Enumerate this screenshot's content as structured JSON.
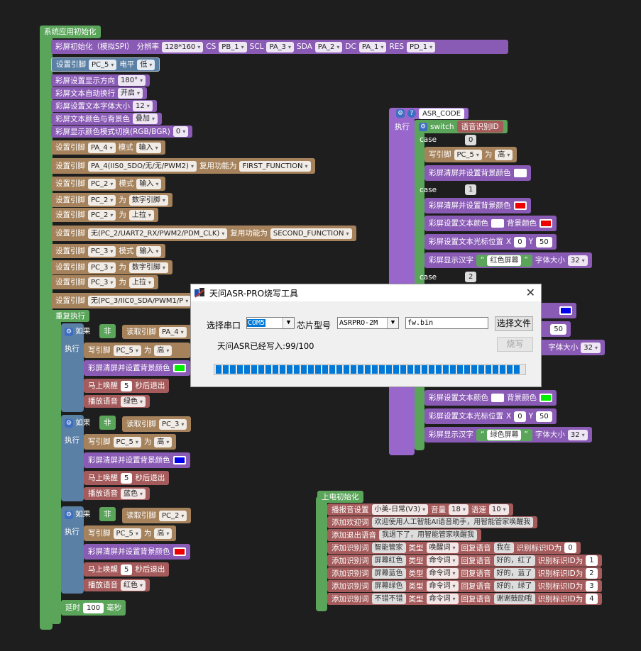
{
  "main": {
    "hat": "系统应用初始化",
    "spi": {
      "label": "彩屏初始化（模拟SPI）",
      "res_label": "分辨率",
      "res": "128*160",
      "cs_label": "CS",
      "cs": "PB_1",
      "scl_label": "SCL",
      "scl": "PA_3",
      "sda_label": "SDA",
      "sda": "PA_2",
      "dc_label": "DC",
      "dc": "PA_1",
      "rst_label": "RES",
      "rst": "PD_1"
    },
    "pin1": {
      "label": "设置引脚",
      "pin": "PC_5",
      "lvl_label": "电平",
      "lvl": "低"
    },
    "dir": {
      "label": "彩屏设置显示方向",
      "val": "180°"
    },
    "wrap": {
      "label": "彩屏文本自动换行",
      "val": "开启"
    },
    "fsize": {
      "label": "彩屏设置文本字体大小",
      "val": "12"
    },
    "blend": {
      "label": "彩屏文本颜色与背景色",
      "val": "叠加"
    },
    "cmode": {
      "label": "彩屏显示颜色模式切换(RGB/BGR)",
      "val": "0"
    },
    "r1": {
      "a": "设置引脚",
      "pin": "PA_4",
      "b": "模式",
      "val": "输入"
    },
    "r2": {
      "a": "设置引脚",
      "pin": "PA_4(IIS0_SDO/无/无/PWM2)",
      "b": "复用功能为",
      "val": "FIRST_FUNCTION"
    },
    "r3": {
      "a": "设置引脚",
      "pin": "PC_2",
      "b": "模式",
      "val": "输入"
    },
    "r4": {
      "a": "设置引脚",
      "pin": "PC_2",
      "b": "为",
      "val": "数字引脚"
    },
    "r5": {
      "a": "设置引脚",
      "pin": "PC_2",
      "b": "为",
      "val": "上拉"
    },
    "r6": {
      "a": "设置引脚",
      "pin": "无(PC_2/UART2_RX/PWM2/PDM_CLK)",
      "b": "复用功能为",
      "val": "SECOND_FUNCTION"
    },
    "r7": {
      "a": "设置引脚",
      "pin": "PC_3",
      "b": "模式",
      "val": "输入"
    },
    "r8": {
      "a": "设置引脚",
      "pin": "PC_3",
      "b": "为",
      "val": "数字引脚"
    },
    "r9": {
      "a": "设置引脚",
      "pin": "PC_3",
      "b": "为",
      "val": "上拉"
    },
    "r10": {
      "a": "设置引脚",
      "pin": "无(PC_3/IIC0_SDA/PWM1/P"
    },
    "repeat": "重复执行",
    "if_kw": "如果",
    "not_kw": "非",
    "read_kw": "读取引脚",
    "exec_kw": "执行",
    "write_kw": "写引脚",
    "as_kw": "为",
    "high": "高",
    "clear_kw": "彩屏清屏并设置背景颜色",
    "wake_kw": "马上唤醒",
    "wake_n": "5",
    "exit_kw": "秒后退出",
    "play_kw": "播放语音",
    "if1": {
      "pin": "PA_4",
      "voice": "绿色"
    },
    "if2": {
      "pin": "PC_3",
      "voice": "蓝色"
    },
    "if3": {
      "pin": "PC_2",
      "voice": "红色"
    },
    "delay": {
      "label": "延时",
      "val": "100",
      "unit": "毫秒"
    }
  },
  "asr": {
    "hat": "ASR_CODE",
    "exec": "执行",
    "switch": "switch",
    "sw_var": "语音识别ID",
    "case": "case",
    "c0": "0",
    "c1": "1",
    "c2": "2",
    "write": "写引脚",
    "pin": "PC_5",
    "as": "为",
    "high": "高",
    "clear": "彩屏清屏并设置背景颜色",
    "tcolor": "彩屏设置文本颜色",
    "bg": "背景颜色",
    "cursor": "彩屏设置文本光标位置",
    "x": "X",
    "y": "Y",
    "xv": "0",
    "yv": "50",
    "show": "彩屏显示汉字",
    "red_text": "红色屏幕",
    "green_text": "绿色屏幕",
    "fs_label": "字体大小",
    "fs": "32"
  },
  "power": {
    "hat": "上电初始化",
    "voice": {
      "label": "播报音设置",
      "val": "小美-日常(V3)",
      "vol_label": "音量",
      "vol": "18",
      "spd_label": "语速",
      "spd": "10"
    },
    "welcome": {
      "label": "添加欢迎词",
      "val": "欢迎使用人工智能AI语音助手，用智能管家唤醒我"
    },
    "exit": {
      "label": "添加退出语音",
      "val": "我退下了，用智能管家唤醒我"
    },
    "words": [
      {
        "label": "添加识别词",
        "word": "智能管家",
        "type_label": "类型",
        "type": "唤醒词",
        "reply_label": "回复语音",
        "reply": "我在",
        "id_label": "识别标识ID为",
        "id": "0"
      },
      {
        "label": "添加识别词",
        "word": "屏幕红色",
        "type_label": "类型",
        "type": "命令词",
        "reply_label": "回复语音",
        "reply": "好的，红了",
        "id_label": "识别标识ID为",
        "id": "1"
      },
      {
        "label": "添加识别词",
        "word": "屏幕蓝色",
        "type_label": "类型",
        "type": "命令词",
        "reply_label": "回复语音",
        "reply": "好的，蓝了",
        "id_label": "识别标识ID为",
        "id": "2"
      },
      {
        "label": "添加识别词",
        "word": "屏幕绿色",
        "type_label": "类型",
        "type": "命令词",
        "reply_label": "回复语音",
        "reply": "好的，绿了",
        "id_label": "识别标识ID为",
        "id": "3"
      },
      {
        "label": "添加识别词",
        "word": "不错不错",
        "type_label": "类型",
        "type": "命令词",
        "reply_label": "回复语音",
        "reply": "谢谢鼓励哦",
        "id_label": "识别标识ID为",
        "id": "4"
      }
    ]
  },
  "dialog": {
    "title": "天问ASR-PRO烧写工具",
    "port_label": "选择串口",
    "port": "COM5",
    "chip_label": "芯片型号",
    "chip": "ASRPRO-2M",
    "file": "fw.bin",
    "choose": "选择文件",
    "burn": "烧写",
    "status": "天问ASR已经写入:99/100",
    "progress": 0.99
  },
  "colors": {
    "green": "#00ee00",
    "red": "#ee0000",
    "blue": "#0000ee",
    "white": "#ffffff"
  }
}
